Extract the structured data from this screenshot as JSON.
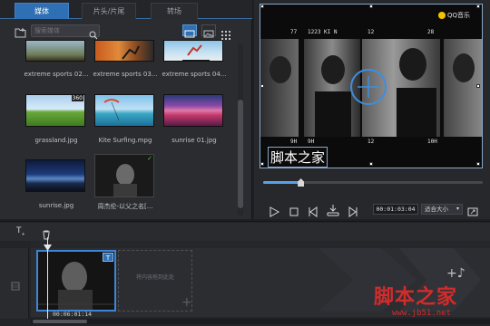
{
  "library": {
    "tabs": [
      {
        "label": "媒体",
        "active": true
      },
      {
        "label": "片头/片尾",
        "active": false
      },
      {
        "label": "转场",
        "active": false
      }
    ],
    "search_placeholder": "搜索媒体",
    "items": [
      {
        "caption": "extreme sports 02...",
        "thumb": "extreme-sports-02"
      },
      {
        "caption": "extreme sports 03...",
        "thumb": "extreme-sports-03"
      },
      {
        "caption": "extreme sports 04...",
        "thumb": "extreme-sports-04"
      },
      {
        "caption": "grassland.jpg",
        "thumb": "grassland",
        "badge": "360"
      },
      {
        "caption": "Kite Surfing.mpg",
        "thumb": "kite-surfing"
      },
      {
        "caption": "sunrise 01.jpg",
        "thumb": "sunrise-01"
      },
      {
        "caption": "sunrise.jpg",
        "thumb": "sunrise"
      },
      {
        "caption": "周杰伦-以父之名[...",
        "thumb": "music-video",
        "checked": true
      }
    ]
  },
  "preview": {
    "qq_logo_text": "QQ音乐",
    "frame_numbers_top": [
      "77",
      "1223 KI N",
      "12",
      "28"
    ],
    "frame_numbers_bottom": [
      "9H",
      "9H",
      "12",
      "10H"
    ],
    "overlay_text": "脚本之家",
    "timecode": "00:01:03:04",
    "fit_label": "适合大小",
    "progress_fraction": 0.17
  },
  "timeline": {
    "clip_duration": "00:06:01:14",
    "dropzone_text": "将内容拖到此处",
    "clip_badge": "T"
  },
  "watermark": {
    "text": "脚本之家",
    "url": "www.jb51.net"
  },
  "colors": {
    "accent": "#2f6fb3",
    "selection": "#3d86d6",
    "watermark": "#d42b2b"
  }
}
